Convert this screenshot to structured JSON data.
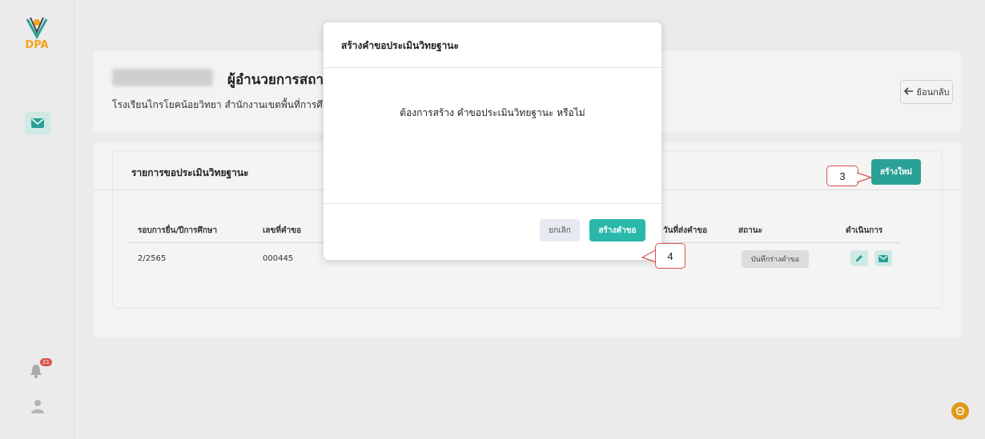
{
  "sidebar": {
    "logo_text": "DPA",
    "notification_count": "21",
    "icons": [
      "mail-icon",
      "bell-icon",
      "user-icon"
    ]
  },
  "header": {
    "title": "ผู้อำนวยการสถา",
    "subtitle": "โรงเรียนไกรโยคน้อยวิทยา สำนักงานเขตพื้นที่การศึ",
    "back_label": "ย้อนกลับ"
  },
  "list": {
    "title": "รายการขอประเมินวิทยฐานะ",
    "new_button_label": "สร้างใหม่",
    "columns": [
      "รอบการยื่น/ปีการศึกษา",
      "เลขที่คำขอ",
      "วันที่ส่งคำขอ",
      "สถานะ",
      "ดำเนินการ"
    ],
    "rows": [
      {
        "round": "2/2565",
        "request_no": "000445",
        "status": "บันทึกร่างคำขอ"
      }
    ]
  },
  "modal": {
    "title": "สร้างคำขอประเมินวิทยฐานะ",
    "message": "ต้องการสร้าง คำขอประเมินวิทยฐานะ หรือไม่",
    "cancel_label": "ยกเลิก",
    "confirm_label": "สร้างคำขอ"
  },
  "callouts": {
    "step3": "3",
    "step4": "4"
  },
  "colors": {
    "accent": "#2aa197",
    "callout_border": "#d9534f",
    "help": "#e09a1a"
  }
}
